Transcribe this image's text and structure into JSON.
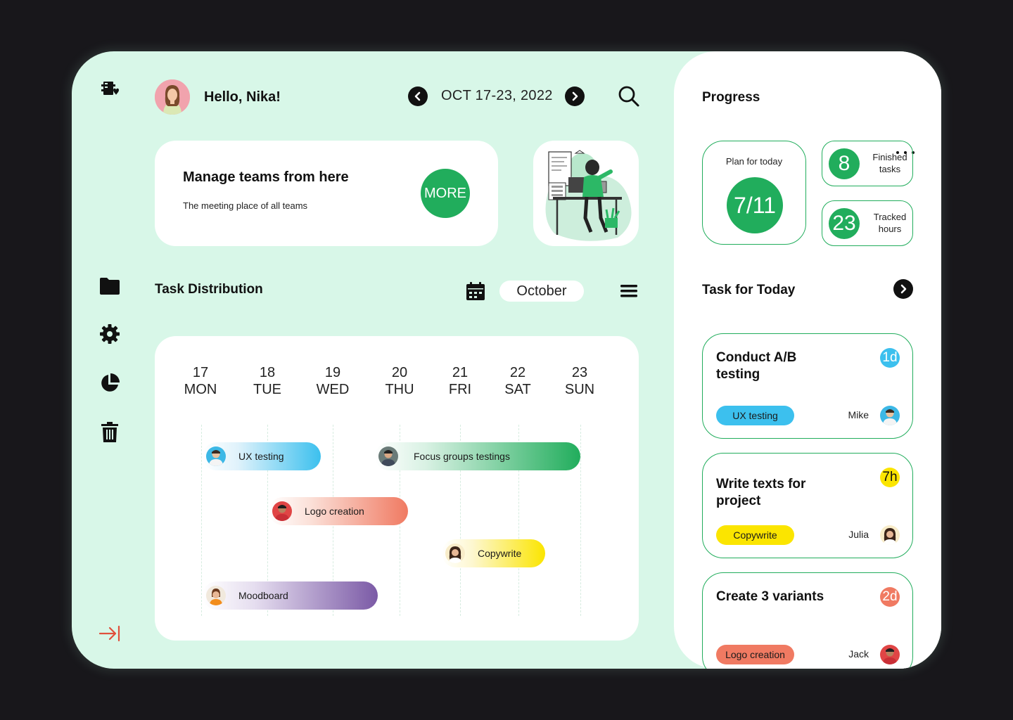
{
  "header": {
    "greeting": "Hello, Nika!",
    "date_range": "OCT 17-23, 2022"
  },
  "banner": {
    "title": "Manage teams from here",
    "subtitle": "The meeting place of all teams",
    "more_label": "MORE"
  },
  "task_distribution": {
    "title": "Task Distribution",
    "month": "October",
    "days": [
      {
        "num": "17",
        "name": "MON"
      },
      {
        "num": "18",
        "name": "TUE"
      },
      {
        "num": "19",
        "name": "WED"
      },
      {
        "num": "20",
        "name": "THU"
      },
      {
        "num": "21",
        "name": "FRI"
      },
      {
        "num": "22",
        "name": "SAT"
      },
      {
        "num": "23",
        "name": "SUN"
      }
    ],
    "tasks": [
      {
        "label": "UX testing"
      },
      {
        "label": "Focus groups testings"
      },
      {
        "label": "Logo creation"
      },
      {
        "label": "Copywrite"
      },
      {
        "label": "Moodboard"
      }
    ]
  },
  "progress": {
    "title": "Progress",
    "plan_label": "Plan for today",
    "plan_value": "7/11",
    "finished_value": "8",
    "finished_label": "Finished tasks",
    "tracked_value": "23",
    "tracked_label": "Tracked hours"
  },
  "tasks_today": {
    "title": "Task for Today",
    "items": [
      {
        "title": "Conduct A/B testing",
        "badge": "1d",
        "tag": "UX testing",
        "person": "Mike"
      },
      {
        "title": "Write texts for project",
        "badge": "7h",
        "tag": "Copywrite",
        "person": "Julia"
      },
      {
        "title": "Create 3 variants",
        "badge": "2d",
        "tag": "Logo creation",
        "person": "Jack"
      }
    ]
  },
  "colors": {
    "accent": "#21ad5c",
    "background": "#d8f7e8",
    "ux_blue": "#3cc0ee",
    "copy_yellow": "#fbe500",
    "logo_coral": "#f07a62",
    "mood_purple": "#7b5aa6"
  },
  "icons": [
    "logo-icon",
    "folder-icon",
    "gear-icon",
    "pie-chart-icon",
    "trash-icon",
    "collapse-icon",
    "search-icon",
    "calendar-icon",
    "menu-icon",
    "chevron-left-icon",
    "chevron-right-icon"
  ]
}
